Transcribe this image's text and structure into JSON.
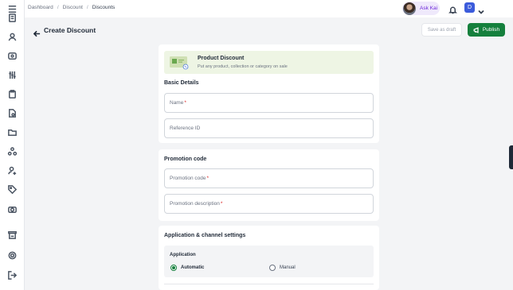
{
  "breadcrumb": {
    "items": [
      "Dashboard",
      "Discount",
      "Discounts"
    ],
    "separator": "/"
  },
  "header": {
    "ask_label": "Ask Kai",
    "user_initial": "D"
  },
  "page": {
    "title": "Create Discount"
  },
  "actions": {
    "draft_label": "Save as draft",
    "publish_label": "Publish"
  },
  "banner": {
    "title": "Product Discount",
    "subtitle": "Put any product, collection or category on sale"
  },
  "basic": {
    "title": "Basic Details",
    "name_placeholder": "Name",
    "reference_placeholder": "Reference ID"
  },
  "promo": {
    "title": "Promotion code",
    "code_placeholder": "Promotion code",
    "description_placeholder": "Promotion description"
  },
  "channel": {
    "title": "Application & channel settings",
    "application_label": "Application",
    "options": [
      {
        "label": "Automatic",
        "selected": true
      },
      {
        "label": "Manual",
        "selected": false
      }
    ]
  },
  "colors": {
    "accent": "#15803d",
    "banner_bg": "#eef5e4",
    "ask_bg": "#efe9fb"
  },
  "sidebar": {
    "icons": [
      "menu-icon",
      "document-icon",
      "user-icon",
      "tag-icon",
      "sliders-icon",
      "clipboard-icon",
      "file-search-icon",
      "folder-icon",
      "network-icon",
      "user-add-icon",
      "label-icon",
      "camera-icon",
      "store-icon",
      "settings-icon",
      "logout-icon"
    ]
  }
}
